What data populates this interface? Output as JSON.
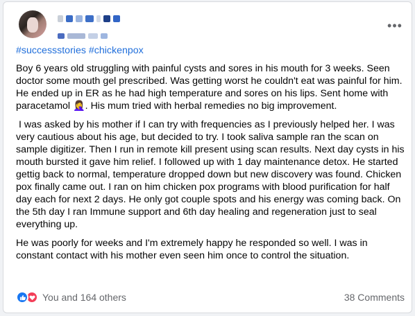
{
  "post": {
    "hashtags": [
      "#successstories",
      "#chickenpox"
    ],
    "paragraphs": [
      "Boy 6 years old struggling with painful cysts and sores in his mouth for 3 weeks. Seen doctor some mouth gel prescribed. Was getting worst he couldn't eat was painful for him. He ended up in ER as he had high temperature and sores on his lips. Sent home with paracetamol 🤦‍♀️. His mum tried with herbal remedies no big improvement.",
      " I was asked by his mother if I can try with frequencies as I previously helped her. I was very cautious about his age, but decided to try. I took saliva sample ran the scan on sample digitizer. Then I run in remote kill present using scan results. Next day cysts in his mouth bursted it gave him relief. I followed up with 1 day maintenance detox. He started gettig back to normal, temperature dropped down but new discovery was found. Chicken pox finally came out. I ran on him chicken pox programs with blood purification for half day each for next 2 days. He only got couple spots and his energy was coming back. On the 5th day I ran Immune support and 6th day healing and regeneration just to seal everything up.",
      "He was poorly for weeks and I'm extremely happy he responded so well. I was in constant contact with his mother even seen him once to control the situation."
    ],
    "reactions": {
      "text": "You and 164 others",
      "icons": [
        "like-icon",
        "love-icon"
      ],
      "like_color": "#1877f2",
      "love_color": "#f33e58"
    },
    "comments_text": "38 Comments",
    "more_label": "•••"
  },
  "colors": {
    "link": "#216fdb",
    "secondary_text": "#65676b",
    "background": "#f0f2f5"
  }
}
